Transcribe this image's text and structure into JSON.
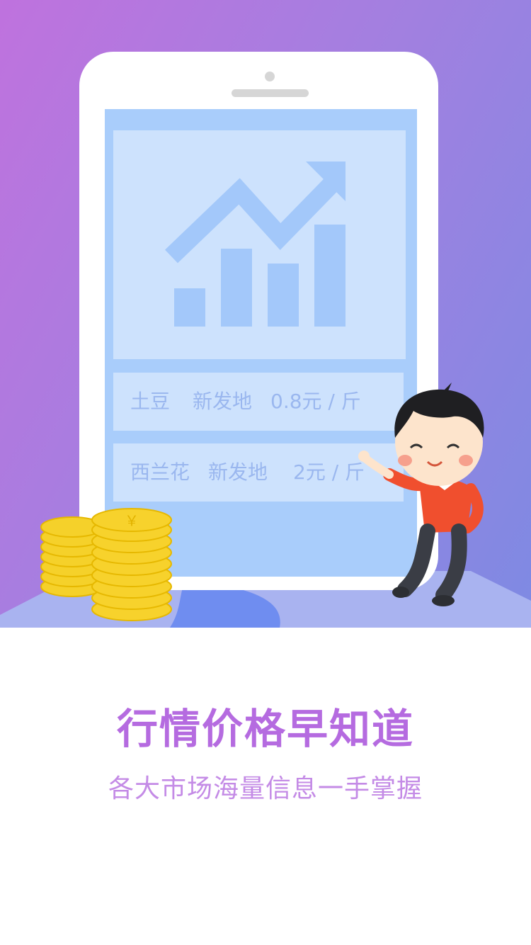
{
  "colors": {
    "gradient_start": "#bf72de",
    "gradient_end": "#7e8ae3",
    "screen_blue": "#a9cdfb",
    "card_blue": "#cde2fd",
    "chart_mark_blue": "#a3c8fa",
    "row_text": "#9ab7ef",
    "headline": "#b56be0",
    "subline": "#c48be6",
    "coin_gold": "#f5d12a"
  },
  "illustration": {
    "chart_icon": "trend-up-bar-chart-icon",
    "coin_symbol": "￥",
    "price_rows": [
      {
        "item": "土豆",
        "market": "新发地",
        "price": "0.8元 / 斤"
      },
      {
        "item": "西兰花",
        "market": "新发地",
        "price": "2元 / 斤"
      }
    ]
  },
  "headline": "行情价格早知道",
  "subline": "各大市场海量信息一手掌握"
}
